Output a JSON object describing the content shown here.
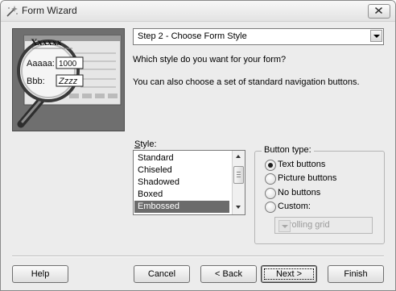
{
  "window": {
    "title": "Form Wizard"
  },
  "picture": {
    "header_text": "Xxxxxx",
    "field1_label": "Aaaaa:",
    "field1_value": "1000",
    "field2_label": "Bbb:",
    "field2_value": "Zzzz"
  },
  "step_combo": {
    "value": "Step 2 - Choose Form Style"
  },
  "question_text": "Which style do you want for your form?",
  "hint_text": "You can also choose a set of standard navigation buttons.",
  "style_list": {
    "label": "Style:",
    "items": [
      "Standard",
      "Chiseled",
      "Shadowed",
      "Boxed",
      "Embossed"
    ],
    "selected": "Embossed"
  },
  "button_type": {
    "label": "Button type:",
    "options": [
      {
        "label": "Text buttons",
        "checked": true
      },
      {
        "label": "Picture buttons",
        "checked": false
      },
      {
        "label": "No buttons",
        "checked": false
      },
      {
        "label": "Custom:",
        "checked": false
      }
    ],
    "custom_combo_value": "Scrolling grid"
  },
  "footer": {
    "help": "Help",
    "cancel": "Cancel",
    "back": "< Back",
    "next": "Next >",
    "finish": "Finish"
  },
  "icons": {
    "app": "wizard-wand-icon",
    "close": "close-icon",
    "dropdown": "chevron-down-icon"
  }
}
